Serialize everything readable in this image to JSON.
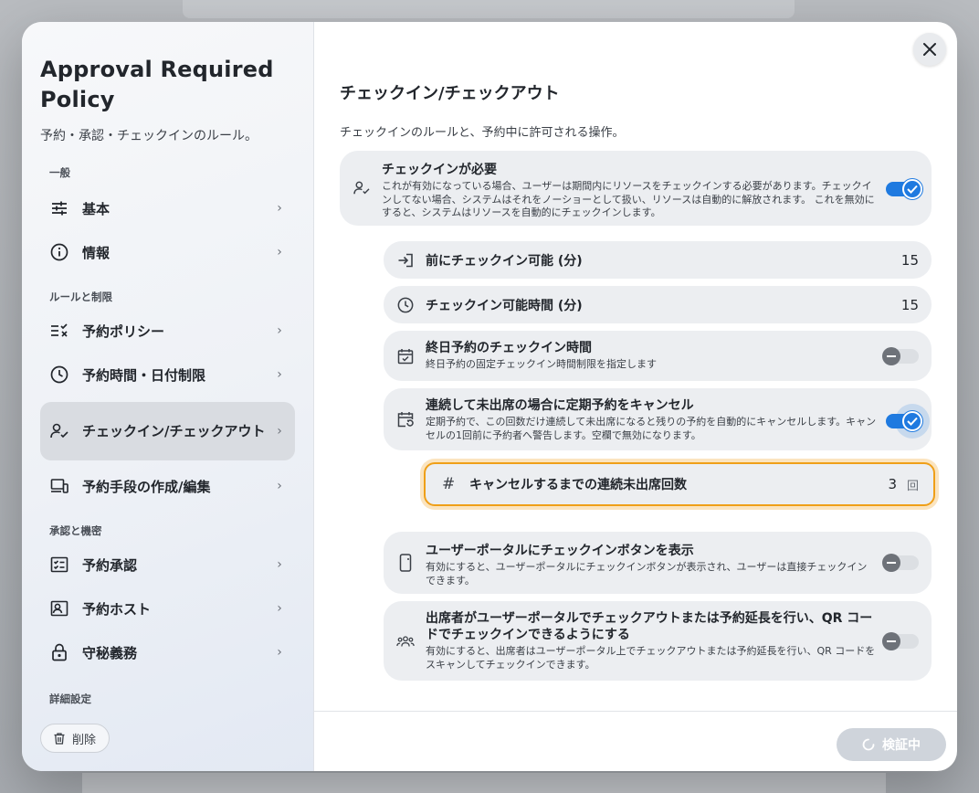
{
  "sidebar": {
    "title": "Approval Required Policy",
    "subtitle": "予約・承認・チェックインのルール。",
    "sections": {
      "general": "一般",
      "rules": "ルールと制限",
      "approval": "承認と機密",
      "advanced": "詳細設定"
    },
    "items": {
      "basic": "基本",
      "info": "情報",
      "booking_policy": "予約ポリシー",
      "time_limits": "予約時間・日付制限",
      "checkin": "チェックイン/チェックアウト",
      "booking_means": "予約手段の作成/編集",
      "booking_approval": "予約承認",
      "booking_host": "予約ホスト",
      "confidentiality": "守秘義務"
    },
    "delete_label": "削除"
  },
  "main": {
    "title": "チェックイン/チェックアウト",
    "subtitle": "チェックインのルールと、予約中に許可される操作。",
    "require_checkin": {
      "title": "チェックインが必要",
      "desc": "これが有効になっている場合、ユーザーは期間内にリソースをチェックインする必要があります。チェックインしてない場合、システムはそれをノーショーとして扱い、リソースは自動的に解放されます。 これを無効にすると、システムはリソースを自動的にチェックインします。",
      "enabled": true
    },
    "checkin_before": {
      "title": "前にチェックイン可能 (分)",
      "value": "15"
    },
    "checkin_window": {
      "title": "チェックイン可能時間 (分)",
      "value": "15"
    },
    "allday_checkin": {
      "title": "終日予約のチェックイン時間",
      "desc": "終日予約の固定チェックイン時間制限を指定します",
      "enabled": false
    },
    "cancel_recurring": {
      "title": "連続して未出席の場合に定期予約をキャンセル",
      "desc": "定期予約で、この回数だけ連続して未出席になると残りの予約を自動的にキャンセルします。キャンセルの1回前に予約者へ警告します。空欄で無効になります。",
      "enabled": true
    },
    "consecutive_noshow": {
      "title": "キャンセルするまでの連続未出席回数",
      "value": "3",
      "unit": "回"
    },
    "portal_checkin_button": {
      "title": "ユーザーポータルにチェックインボタンを表示",
      "desc": "有効にすると、ユーザーポータルにチェックインボタンが表示され、ユーザーは直接チェックインできます。",
      "enabled": false
    },
    "attendee_actions": {
      "title": "出席者がユーザーポータルでチェックアウトまたは予約延長を行い、QR コードでチェックインできるようにする",
      "desc": "有効にすると、出席者はユーザーポータル上でチェックアウトまたは予約延長を行い、QR コードをスキャンしてチェックインできます。",
      "enabled": false
    }
  },
  "footer": {
    "verify_label": "検証中"
  },
  "colors": {
    "accent": "#1f7ae0",
    "focus": "#ef9f18"
  }
}
